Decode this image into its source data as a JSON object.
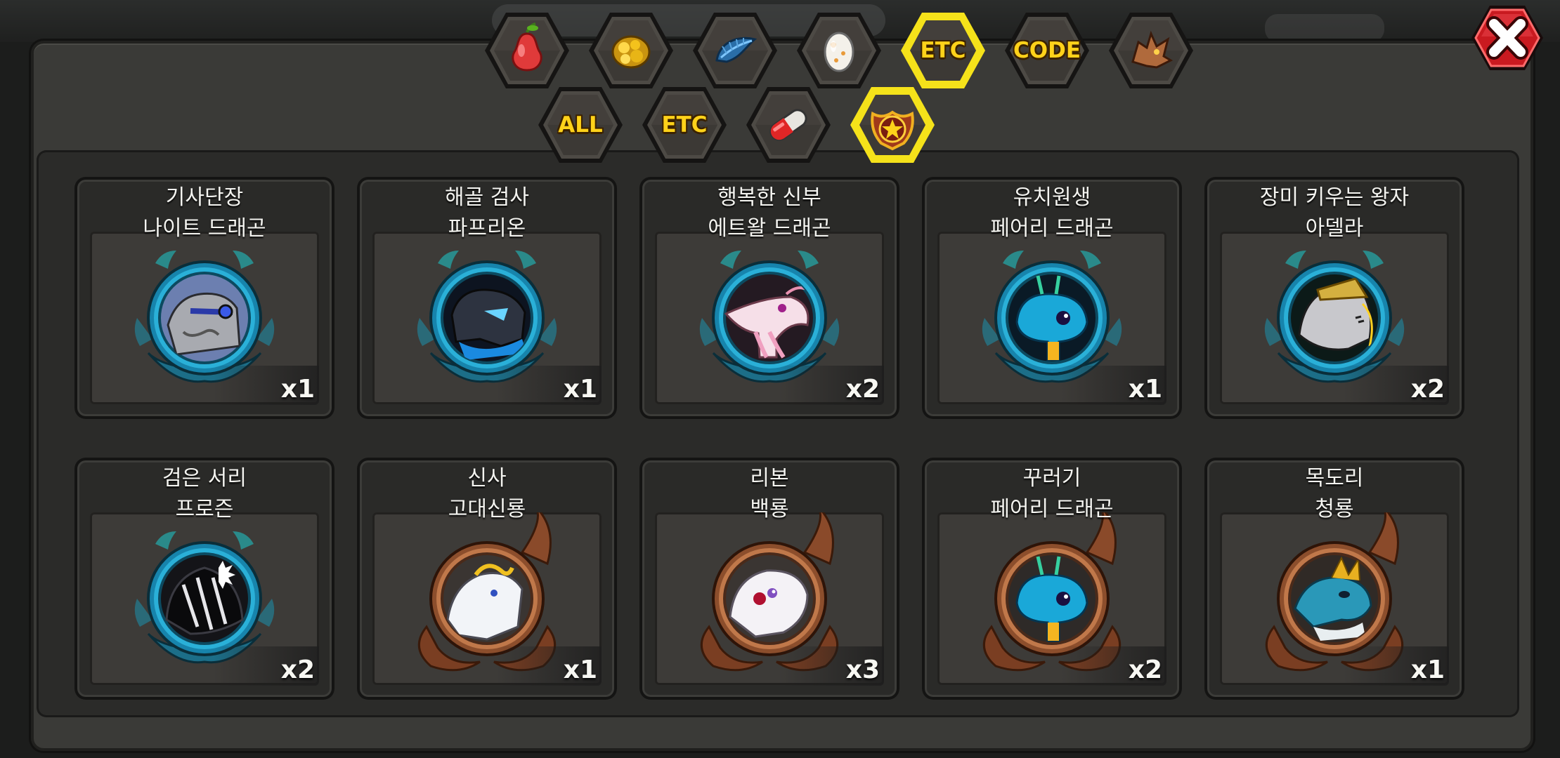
{
  "tabs_row1": [
    {
      "name": "fruit-tab",
      "icon": "pear-icon",
      "label": ""
    },
    {
      "name": "gold-tab",
      "icon": "gold-nugget-icon",
      "label": ""
    },
    {
      "name": "feather-tab",
      "icon": "blue-feather-icon",
      "label": ""
    },
    {
      "name": "egg-tab",
      "icon": "egg-icon",
      "label": ""
    },
    {
      "name": "etc-top-tab",
      "icon": "",
      "label": "ETC",
      "selected": true
    },
    {
      "name": "code-tab",
      "icon": "",
      "label": "CODE"
    },
    {
      "name": "dragon-tab",
      "icon": "dragon-head-icon",
      "label": ""
    }
  ],
  "tabs_row2": [
    {
      "name": "all-tab",
      "icon": "",
      "label": "ALL"
    },
    {
      "name": "etc-sub-tab",
      "icon": "",
      "label": "ETC"
    },
    {
      "name": "capsule-tab",
      "icon": "capsule-icon",
      "label": ""
    },
    {
      "name": "emblem-tab",
      "icon": "star-emblem-icon",
      "label": "",
      "selected": true
    }
  ],
  "close": {
    "icon": "close-icon"
  },
  "colors": {
    "tab_text": "#ffd21a",
    "selected_border": "#f5e21a",
    "frame_blue": "#1e8fb8",
    "frame_bronze": "#9a5a35",
    "close_red": "#d92027"
  },
  "items": [
    {
      "line1": "기사단장",
      "line2": "나이트 드래곤",
      "qty": "x1",
      "frame": "blue",
      "portrait": "knight-dragon"
    },
    {
      "line1": "해골 검사",
      "line2": "파프리온",
      "qty": "x1",
      "frame": "blue",
      "portrait": "skull-swordsman"
    },
    {
      "line1": "행복한 신부",
      "line2": "에트왈 드래곤",
      "qty": "x2",
      "frame": "blue",
      "portrait": "happy-bride"
    },
    {
      "line1": "유치원생",
      "line2": "페어리 드래곤",
      "qty": "x1",
      "frame": "blue",
      "portrait": "kindergarten-fairy"
    },
    {
      "line1": "장미 키우는 왕자",
      "line2": "아델라",
      "qty": "x2",
      "frame": "blue",
      "portrait": "rose-prince"
    },
    {
      "line1": "검은 서리",
      "line2": "프로즌",
      "qty": "x2",
      "frame": "blue",
      "portrait": "black-frost"
    },
    {
      "line1": "신사",
      "line2": "고대신룡",
      "qty": "x1",
      "frame": "bronze",
      "portrait": "gentleman-ancient"
    },
    {
      "line1": "리본",
      "line2": "백룡",
      "qty": "x3",
      "frame": "bronze",
      "portrait": "ribbon-white"
    },
    {
      "line1": "꾸러기",
      "line2": "페어리 드래곤",
      "qty": "x2",
      "frame": "bronze",
      "portrait": "naughty-fairy"
    },
    {
      "line1": "목도리",
      "line2": "청룡",
      "qty": "x1",
      "frame": "bronze",
      "portrait": "scarf-blue"
    }
  ]
}
